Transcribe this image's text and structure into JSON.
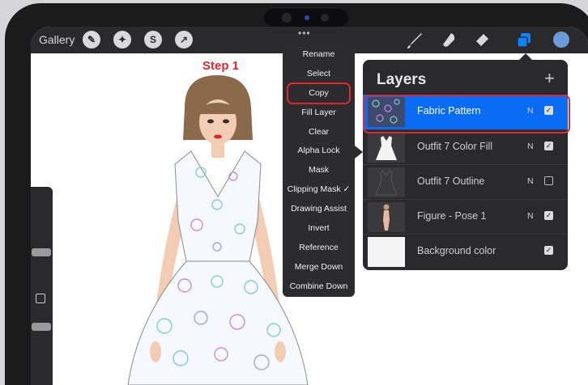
{
  "topbar": {
    "gallery_label": "Gallery",
    "more_label": "•••",
    "tools_left": [
      "wrench-icon",
      "magic-wand-icon",
      "selection-icon",
      "transform-arrow-icon"
    ],
    "tools_right": [
      "brush-icon",
      "smudge-icon",
      "eraser-icon",
      "layers-icon",
      "color-swatch"
    ],
    "accent_color": "#0a84ff",
    "color_swatch": "#6b9bd6"
  },
  "annotation": {
    "step_label": "Step 1",
    "highlight_color": "#e0262e"
  },
  "context_menu": {
    "items": [
      "Rename",
      "Select",
      "Copy",
      "Fill Layer",
      "Clear",
      "Alpha Lock",
      "Mask",
      "Clipping Mask ✓",
      "Drawing Assist",
      "Invert",
      "Reference",
      "Merge Down",
      "Combine Down"
    ]
  },
  "layers_panel": {
    "title": "Layers",
    "add_label": "+",
    "layers": [
      {
        "name": "Fabric Pattern",
        "mode": "N",
        "visible": "✓",
        "selected": true
      },
      {
        "name": "Outfit 7 Color Fill",
        "mode": "N",
        "visible": "✓",
        "selected": false
      },
      {
        "name": "Outfit 7 Outline",
        "mode": "N",
        "visible": "",
        "selected": false
      },
      {
        "name": "Figure - Pose 1",
        "mode": "N",
        "visible": "✓",
        "selected": false
      },
      {
        "name": "Background color",
        "mode": "",
        "visible": "✓",
        "selected": false
      }
    ]
  }
}
